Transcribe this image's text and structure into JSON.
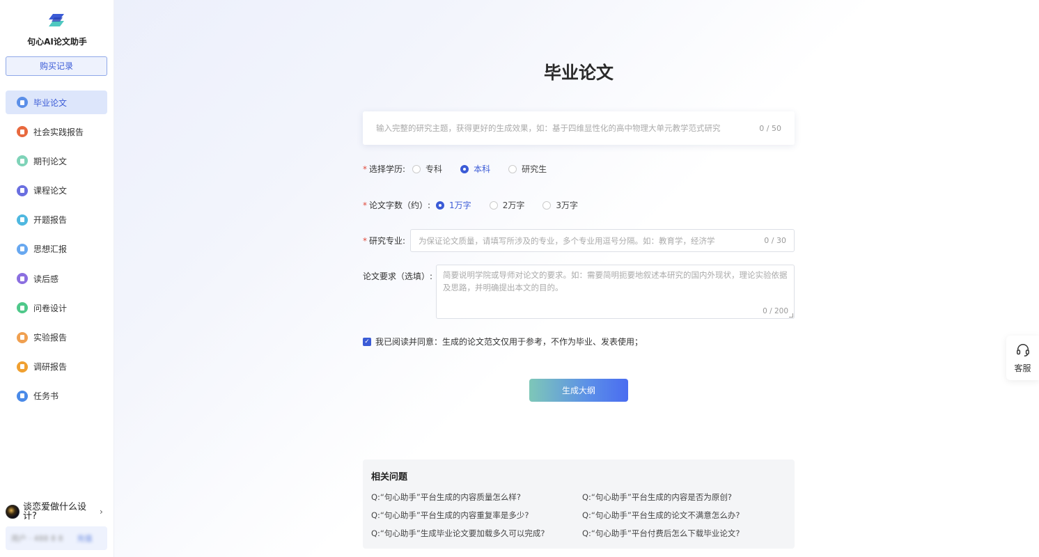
{
  "sidebar": {
    "brand": "句心AI论文助手",
    "purchase_button": "购买记录",
    "items": [
      {
        "label": "毕业论文",
        "color": "#5b8fe8",
        "active": true
      },
      {
        "label": "社会实践报告",
        "color": "#e8693e"
      },
      {
        "label": "期刊论文",
        "color": "#7fd3b8"
      },
      {
        "label": "课程论文",
        "color": "#6a6fe0"
      },
      {
        "label": "开题报告",
        "color": "#4fb8e0"
      },
      {
        "label": "思想汇报",
        "color": "#68a8f0"
      },
      {
        "label": "读后感",
        "color": "#8b6fe0"
      },
      {
        "label": "问卷设计",
        "color": "#4fc88a"
      },
      {
        "label": "实验报告",
        "color": "#f0a050"
      },
      {
        "label": "调研报告",
        "color": "#f0a030"
      },
      {
        "label": "任务书",
        "color": "#4a8ae8"
      }
    ],
    "user": {
      "name": "谈恋爱做什么设计?"
    },
    "account": {
      "text": "用户 · 488 8 8",
      "link": "充值"
    }
  },
  "main": {
    "title": "毕业论文",
    "topic": {
      "placeholder": "输入完整的研究主题，获得更好的生成效果，如：基于四维显性化的高中物理大单元教学范式研究",
      "counter": "0 / 50"
    },
    "education": {
      "label": "选择学历:",
      "options": [
        "专科",
        "本科",
        "研究生"
      ],
      "selected": "本科"
    },
    "wordcount": {
      "label": "论文字数（约）:",
      "options": [
        "1万字",
        "2万字",
        "3万字"
      ],
      "selected": "1万字"
    },
    "major": {
      "label": "研究专业:",
      "placeholder": "为保证论文质量，请填写所涉及的专业，多个专业用逗号分隔。如：教育学，经济学",
      "counter": "0 / 30"
    },
    "requirements": {
      "label": "论文要求（选填）:",
      "placeholder": "简要说明学院或导师对论文的要求。如：需要简明扼要地叙述本研究的国内外现状，理论实验依据及思路，并明确提出本文的目的。",
      "counter": "0 / 200"
    },
    "agreement": "我已阅读并同意：生成的论文范文仅用于参考，不作为毕业、发表使用；",
    "generate_button": "生成大纲",
    "faq": {
      "title": "相关问题",
      "items": [
        "Q:“句心助手”平台生成的内容质量怎么样?",
        "Q:“句心助手”平台生成的内容是否为原创?",
        "Q:“句心助手”平台生成的内容重复率是多少?",
        "Q:“句心助手”平台生成的论文不满意怎么办?",
        "Q:“句心助手”生成毕业论文要加载多久可以完成?",
        "Q:“句心助手”平台付费后怎么下载毕业论文?"
      ]
    }
  },
  "customer_service": {
    "label": "客服"
  }
}
